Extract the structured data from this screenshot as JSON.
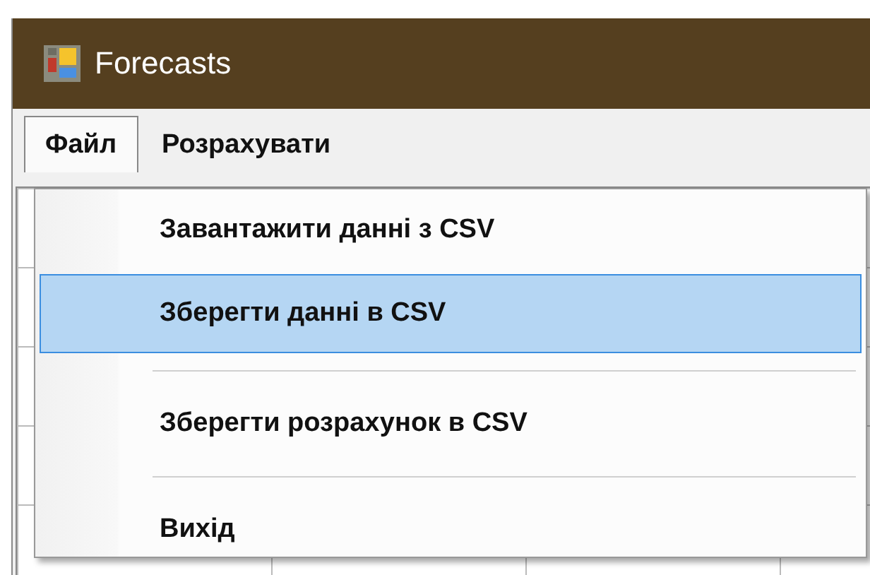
{
  "window": {
    "title": "Forecasts"
  },
  "menu_bar": [
    {
      "label": "Файл",
      "selected": true
    },
    {
      "label": "Розрахувати",
      "selected": false
    }
  ],
  "dropdown": [
    {
      "kind": "item",
      "label": "Завантажити данні з CSV",
      "highlighted": false
    },
    {
      "kind": "item",
      "label": "Зберегти данні в CSV",
      "highlighted": true
    },
    {
      "kind": "separator"
    },
    {
      "kind": "item",
      "label": "Зберегти розрахунок в CSV",
      "highlighted": false
    },
    {
      "kind": "separator"
    },
    {
      "kind": "item",
      "label": "Вихід",
      "highlighted": false
    }
  ]
}
